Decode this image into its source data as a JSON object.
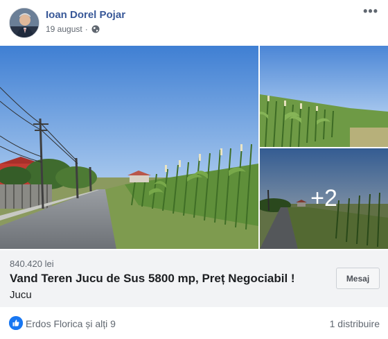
{
  "post": {
    "author": "Ioan Dorel Pojar",
    "date": "19 august",
    "separator": "·",
    "privacy_icon": "globe-icon",
    "more_icon": "more-options-icon"
  },
  "photos": {
    "extra_count": "+2"
  },
  "listing": {
    "price": "840.420 lei",
    "title": "Vand Teren Jucu de Sus 5800 mp, Preț Negociabil !",
    "location": "Jucu",
    "message_button": "Mesaj"
  },
  "footer": {
    "reaction_icon": "like-icon",
    "reactors": "Erdos Florica și alți 9",
    "shares": "1 distribuire"
  },
  "colors": {
    "author_link": "#385898",
    "like_blue": "#1877f2",
    "listing_bg": "#f2f3f5",
    "sky": "#5b8fd6"
  }
}
